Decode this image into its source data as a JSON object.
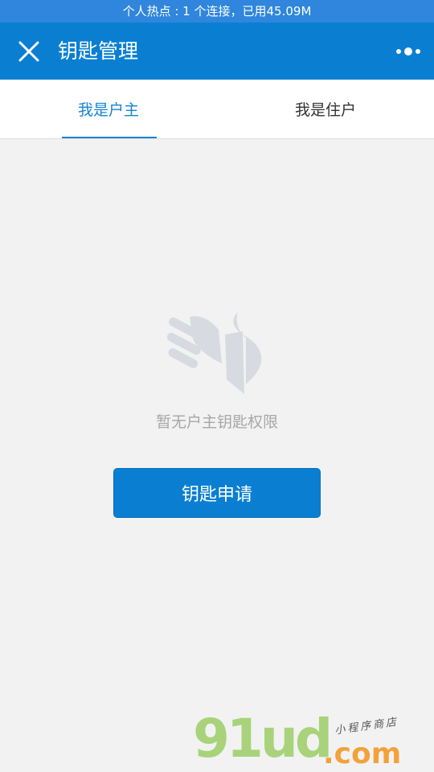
{
  "status_bar": {
    "hotspot_text": "个人热点 : 1 个连接，已用45.09M",
    "bar_color": "#2f86dc"
  },
  "nav": {
    "title": "钥匙管理",
    "close_icon": "close-icon",
    "more_icon": "more-dots-icon",
    "bar_color": "#0a7fd2"
  },
  "tabs": [
    {
      "label": "我是户主",
      "active": true
    },
    {
      "label": "我是住户",
      "active": false
    }
  ],
  "colors": {
    "accent": "#1485d4",
    "page_background": "#f2f2f2",
    "empty_text": "#a7a7a7",
    "illustration": "#d7dbe1"
  },
  "empty_state": {
    "icon": "hand-key-icon",
    "message": "暂无户主钥匙权限"
  },
  "apply_button": {
    "label": "钥匙申请"
  },
  "watermark": {
    "main_text": "91ud",
    "suffix": ".com",
    "subtitle": "小程序商店"
  }
}
